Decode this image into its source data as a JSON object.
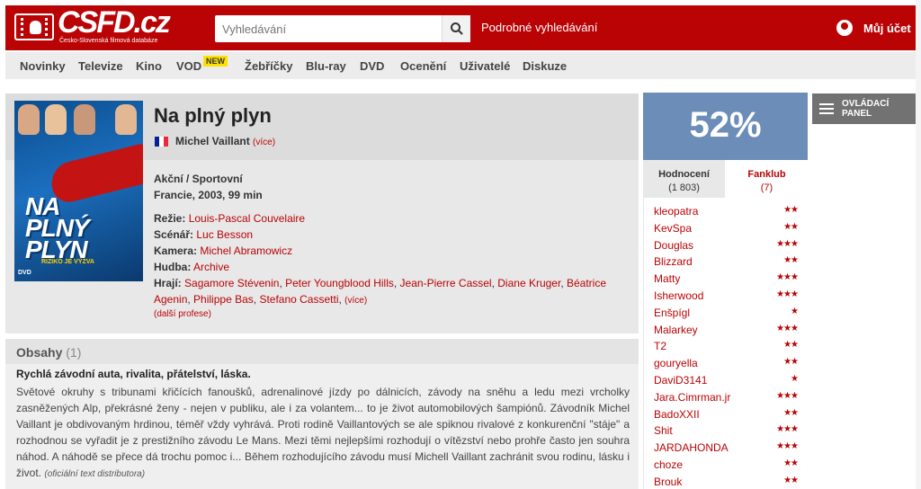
{
  "header": {
    "logo_text": "CSFD.cz",
    "logo_subtitle": "Česko-Slovenská filmová databáze",
    "search_placeholder": "Vyhledávání",
    "advanced_search": "Podrobné vyhledávání",
    "account_label": "Můj účet"
  },
  "nav": {
    "items": [
      "Novinky",
      "Televize",
      "Kino",
      "VOD",
      "Žebříčky",
      "Blu-ray",
      "DVD",
      "Ocenění",
      "Uživatelé",
      "Diskuze"
    ],
    "vod_badge": "NEW"
  },
  "film": {
    "title": "Na plný plyn",
    "alt_title": "Michel Vaillant",
    "alt_more": "(více)",
    "flag_colors": [
      "#002395",
      "#ffffff",
      "#ed2939"
    ],
    "genre": "Akční / Sportovní",
    "origin": "Francie, 2003, 99 min",
    "director_label": "Režie:",
    "director": "Louis-Pascal Couvelaire",
    "screenplay_label": "Scénář:",
    "screenplay": "Luc Besson",
    "camera_label": "Kamera:",
    "camera": "Michel Abramowicz",
    "music_label": "Hudba:",
    "music": "Archive",
    "cast_label": "Hrají:",
    "cast": [
      "Sagamore Stévenin",
      "Peter Youngblood Hills",
      "Jean-Pierre Cassel",
      "Diane Kruger",
      "Béatrice Agenin",
      "Philippe Bas",
      "Stefano Cassetti"
    ],
    "cast_more": "(více)",
    "other_professions": "(další profese)",
    "poster": {
      "title_line1": "NA",
      "title_line2": "PLNÝ",
      "title_line3": "PLYN",
      "tagline": "RIZIKO JE VÝZVA",
      "dvd": "DVD"
    }
  },
  "plot": {
    "heading": "Obsahy",
    "count": "(1)",
    "lead": "Rychlá závodní auta, rivalita, přátelství, láska.",
    "text": "Světové okruhy s tribunami křičících fanoušků, adrenalinové jízdy po dálnicích, závody na sněhu a ledu mezi vrcholky zasněžených Alp, překrásné ženy - nejen v publiku, ale i za volantem... to je život automobilových šampiónů. Závodník Michel Vaillant je obdivovaným hrdinou, téměř vždy vyhrává. Proti rodině Vaillantových se ale spiknou rivalové z konkurenční \"stáje\" a rozhodnou se vyřadit je z prestižního závodu Le Mans. Mezi těmi nejlepšími rozhodují o vítězství nebo prohře často jen souhra náhod. A náhodě se přece dá trochu pomoc i... Během rozhodujícího závodu musí Michell Vaillant zachránit svou rodinu, lásku i život.",
    "source": "(oficiální text distributora)"
  },
  "rating": {
    "percent": "52%",
    "tab_ratings": "Hodnocení",
    "tab_ratings_count": "(1 803)",
    "tab_fanclub": "Fanklub",
    "tab_fanclub_count": "(7)",
    "users": [
      {
        "name": "kleopatra",
        "stars": "★★"
      },
      {
        "name": "KevSpa",
        "stars": "★★"
      },
      {
        "name": "Douglas",
        "stars": "★★★"
      },
      {
        "name": "Blizzard",
        "stars": "★★"
      },
      {
        "name": "Matty",
        "stars": "★★★"
      },
      {
        "name": "Isherwood",
        "stars": "★★★"
      },
      {
        "name": "Enšpígl",
        "stars": "★"
      },
      {
        "name": "Malarkey",
        "stars": "★★★"
      },
      {
        "name": "T2",
        "stars": "★★"
      },
      {
        "name": "gouryella",
        "stars": "★★"
      },
      {
        "name": "DaviD3141",
        "stars": "★"
      },
      {
        "name": "Jara.Cimrman.jr",
        "stars": "★★★"
      },
      {
        "name": "BadoXXII",
        "stars": "★★"
      },
      {
        "name": "Shit",
        "stars": "★★★"
      },
      {
        "name": "JARDAHONDA",
        "stars": "★★★"
      },
      {
        "name": "choze",
        "stars": "★★"
      },
      {
        "name": "Brouk",
        "stars": "★★"
      }
    ]
  },
  "control_panel": {
    "label": "OVLÁDACÍ PANEL"
  },
  "colors": {
    "brand_red": "#ba0305",
    "rating_blue": "#6b8db8",
    "panel_gray": "#727272"
  }
}
